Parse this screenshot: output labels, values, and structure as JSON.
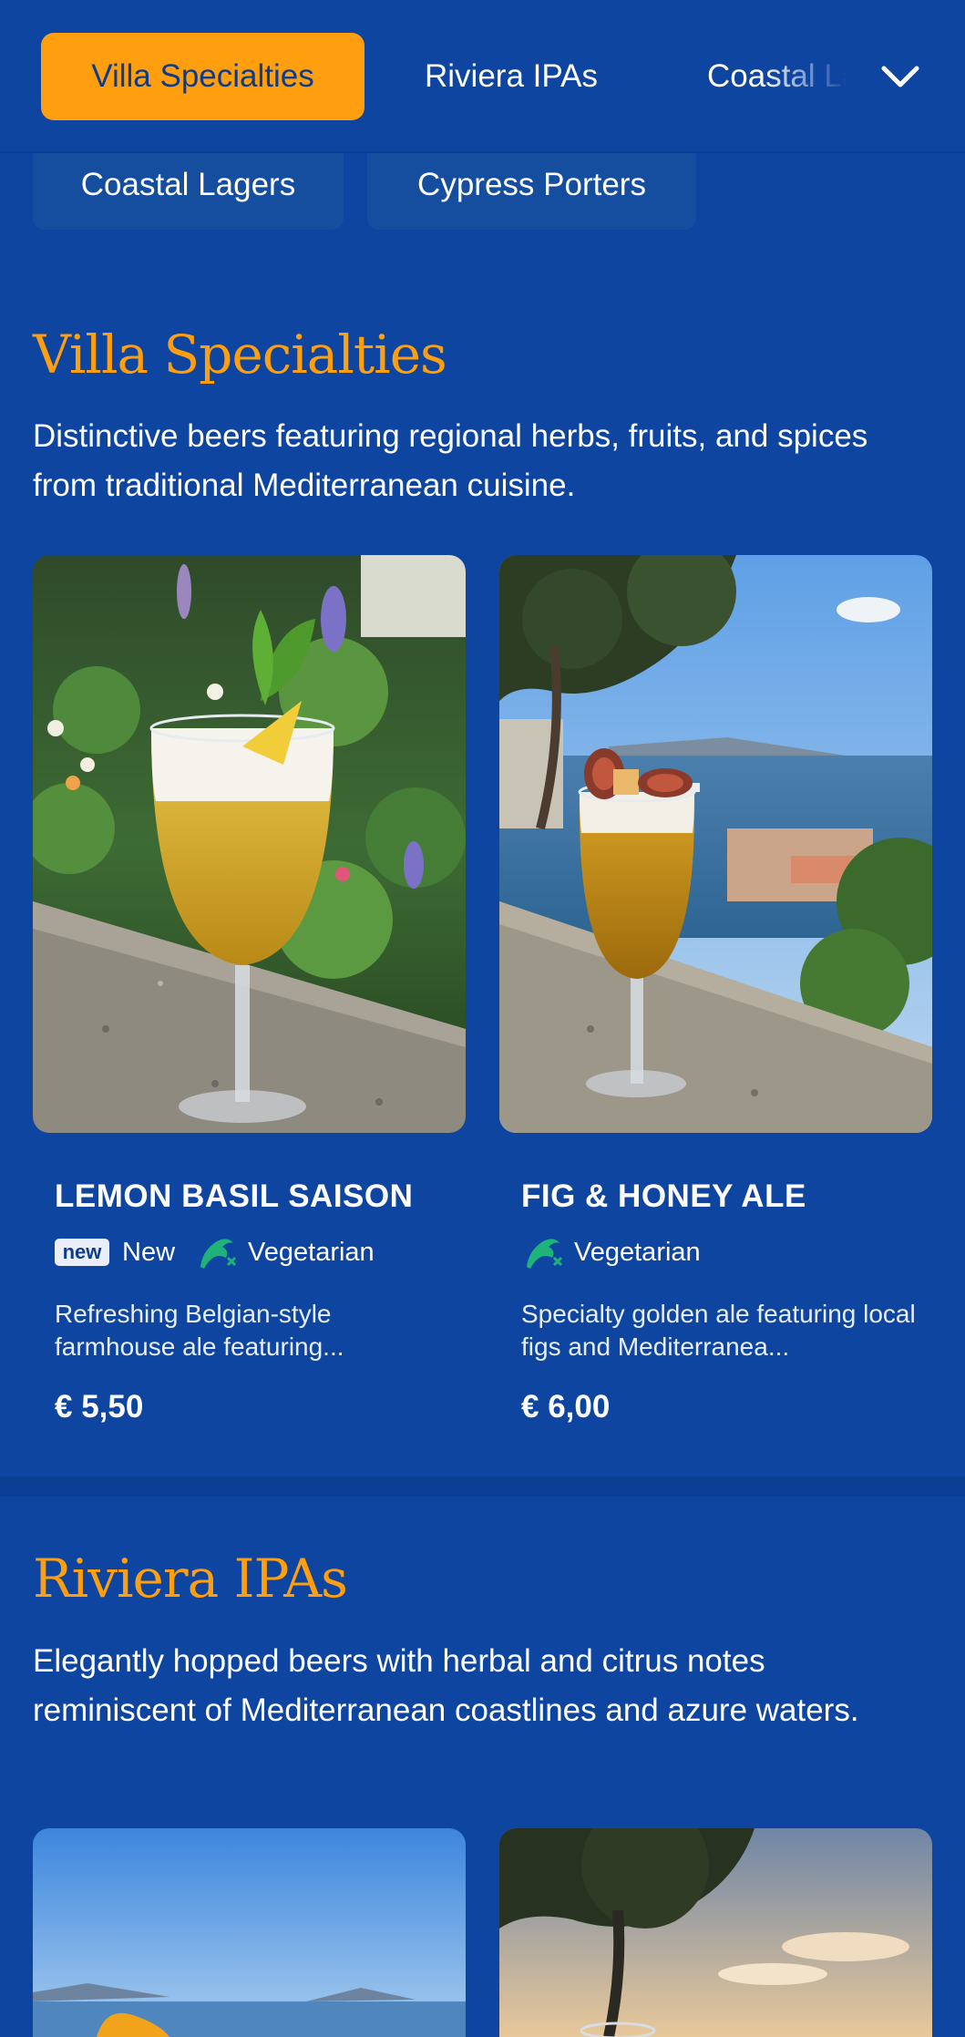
{
  "tabs": {
    "items": [
      {
        "label": "Villa Specialties",
        "active": true
      },
      {
        "label": "Riviera IPAs",
        "active": false
      },
      {
        "label": "Coastal Lagers",
        "active": false
      }
    ],
    "overflow": [
      "Coastal Lagers",
      "Cypress Porters"
    ],
    "expand_icon": "chevron-down-icon"
  },
  "sections": [
    {
      "title": "Villa Specialties",
      "description": "Distinctive beers featuring regional herbs, fruits, and spices from traditional Mediterranean cuisine.",
      "items": [
        {
          "name": "LEMON BASIL SAISON",
          "badge": "new",
          "badge_label": "New",
          "diet": "Vegetarian",
          "diet_icon": "vegetarian-icon",
          "description": "Refreshing Belgian-style farmhouse ale featuring...",
          "price": "€ 5,50"
        },
        {
          "name": "FIG & HONEY ALE",
          "diet": "Vegetarian",
          "diet_icon": "vegetarian-icon",
          "description": "Specialty golden ale featuring local figs and Mediterranea...",
          "price": "€ 6,00"
        }
      ]
    },
    {
      "title": "Riviera IPAs",
      "description": "Elegantly hopped beers with herbal and citrus notes reminiscent of Mediterranean coastlines and azure waters."
    }
  ],
  "colors": {
    "background": "#0d45a0",
    "accent": "#ff9f0f",
    "vegetarian": "#1fb27a",
    "badge": "#e9eef8"
  }
}
